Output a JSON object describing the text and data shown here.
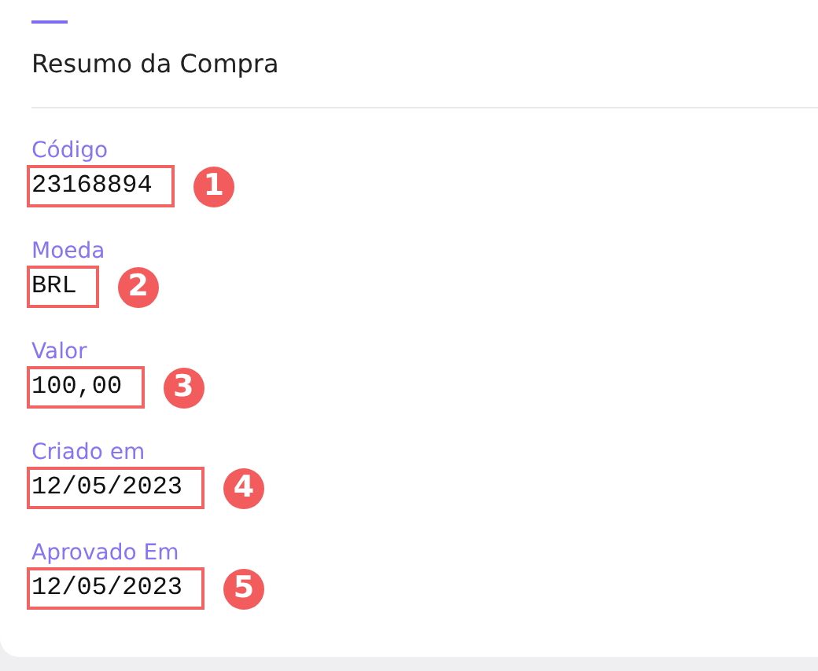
{
  "card": {
    "title": "Resumo da Compra",
    "fields": [
      {
        "label": "Código",
        "value": "23168894",
        "marker": "1"
      },
      {
        "label": "Moeda",
        "value": "BRL",
        "marker": "2"
      },
      {
        "label": "Valor",
        "value": "100,00",
        "marker": "3"
      },
      {
        "label": "Criado em",
        "value": "12/05/2023",
        "marker": "4"
      },
      {
        "label": "Aprovado Em",
        "value": "12/05/2023",
        "marker": "5"
      }
    ]
  }
}
